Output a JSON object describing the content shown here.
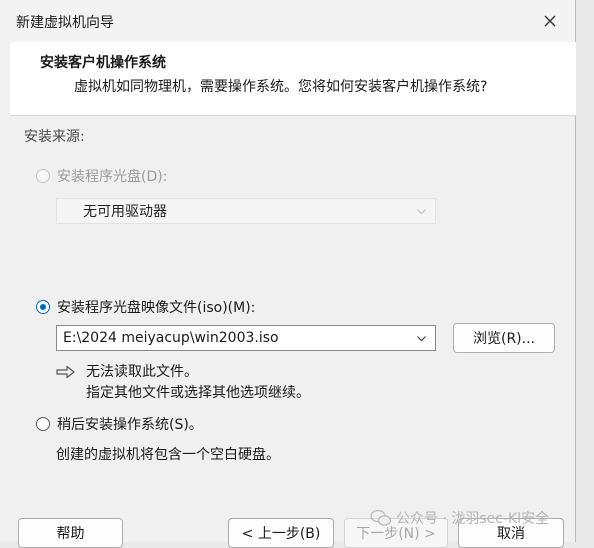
{
  "window": {
    "title": "新建虚拟机向导"
  },
  "header": {
    "title": "安装客户机操作系统",
    "subtitle": "虚拟机如同物理机，需要操作系统。您将如何安装客户机操作系统?"
  },
  "install_source": {
    "label": "安装来源:",
    "options": [
      {
        "label": "安装程序光盘(D):",
        "selected": false,
        "enabled": false,
        "dropdown_value": "无可用驱动器"
      },
      {
        "label": "安装程序光盘映像文件(iso)(M):",
        "selected": true,
        "enabled": true,
        "dropdown_value": "E:\\2024 meiyacup\\win2003.iso",
        "browse_label": "浏览(R)...",
        "messages": [
          "无法读取此文件。",
          "指定其他文件或选择其他选项继续。"
        ]
      },
      {
        "label": "稍后安装操作系统(S)。",
        "selected": false,
        "enabled": true,
        "note": "创建的虚拟机将包含一个空白硬盘。"
      }
    ]
  },
  "footer": {
    "help_label": "帮助",
    "back_label": "< 上一步(B)",
    "next_label": "下一步(N) >",
    "cancel_label": "取消"
  },
  "watermark": {
    "text": "公众号 · 泷羽sec-Kl安全"
  },
  "colors": {
    "accent": "#0067c0",
    "window_bg": "#f0f0f0",
    "header_bg": "#ffffff"
  }
}
